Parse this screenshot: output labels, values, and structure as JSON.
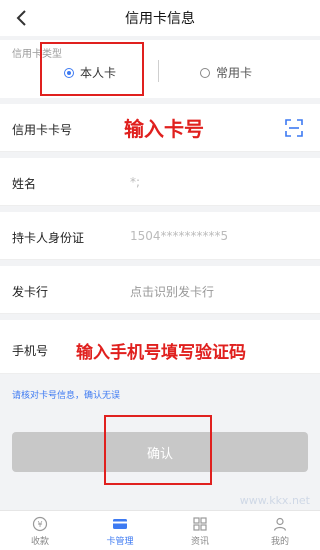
{
  "header": {
    "title": "信用卡信息"
  },
  "card_type": {
    "label": "信用卡类型",
    "options": [
      {
        "label": "本人卡",
        "selected": true
      },
      {
        "label": "常用卡",
        "selected": false
      }
    ]
  },
  "form": {
    "card_number": {
      "label": "信用卡卡号",
      "value": "输入卡号"
    },
    "name": {
      "label": "姓名",
      "value": "*;"
    },
    "id_card": {
      "label": "持卡人身份证",
      "value": "1504**********5"
    },
    "bank": {
      "label": "发卡行",
      "placeholder": "点击识别发卡行"
    },
    "phone": {
      "label": "手机号",
      "value": "输入手机号填写验证码"
    }
  },
  "hint": "请核对卡号信息，确认无误",
  "confirm_button": "确认",
  "tabbar": {
    "items": [
      {
        "label": "收款",
        "icon": "money-icon",
        "active": false
      },
      {
        "label": "卡管理",
        "icon": "card-icon",
        "active": true
      },
      {
        "label": "资讯",
        "icon": "grid-icon",
        "active": false
      },
      {
        "label": "我的",
        "icon": "user-icon",
        "active": false
      }
    ]
  },
  "watermark": "www.kkx.net",
  "colors": {
    "accent": "#3d7af2",
    "annotation": "#e0201e",
    "button_disabled": "#c8c8c8"
  }
}
